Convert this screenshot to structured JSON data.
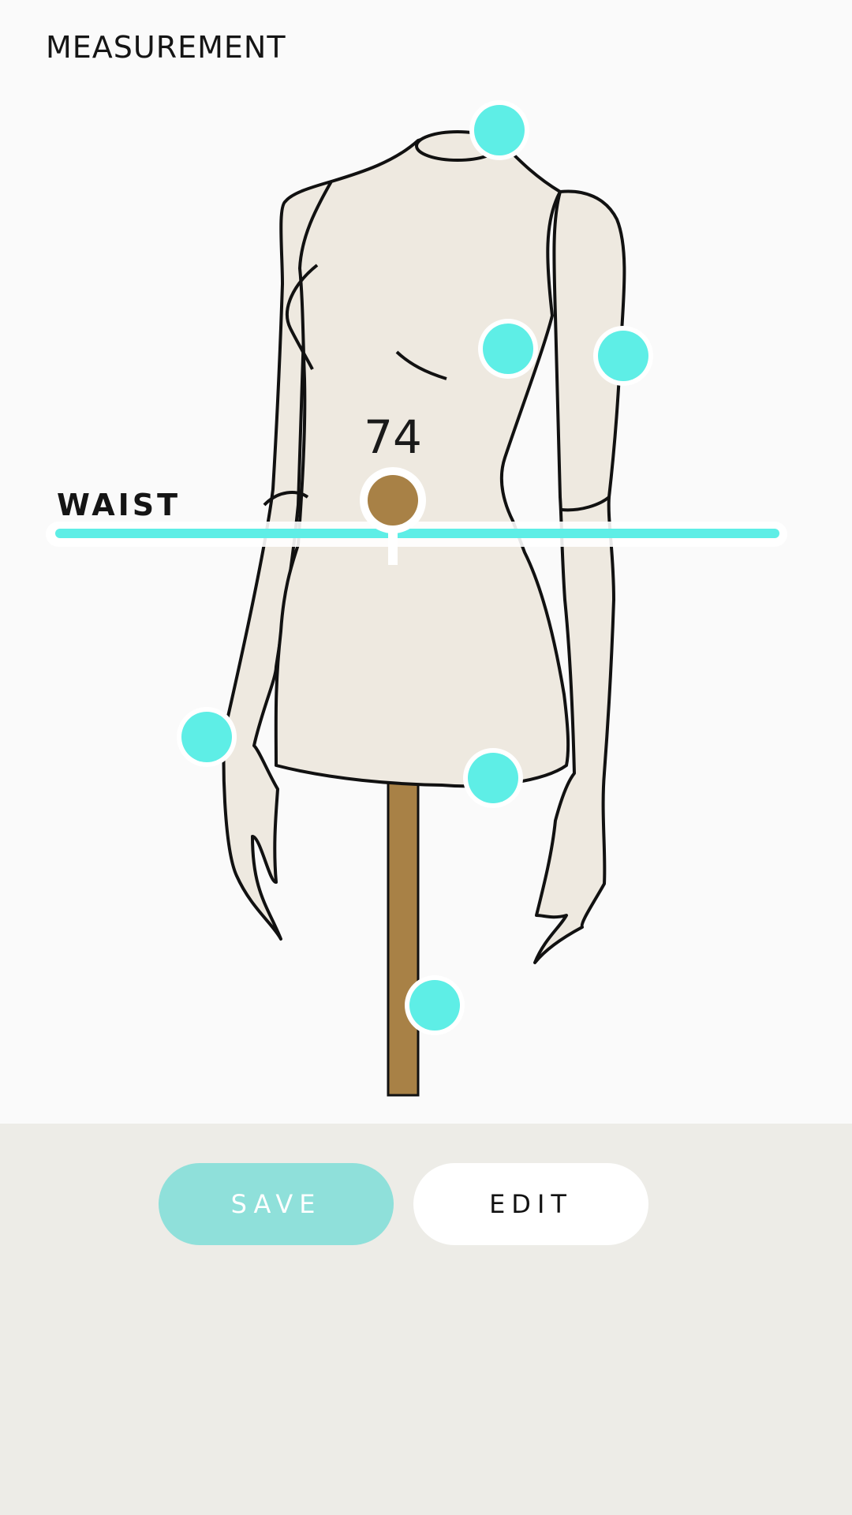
{
  "header": {
    "title": "MEASUREMENT"
  },
  "measurement": {
    "label": "WAIST",
    "value": "74"
  },
  "colors": {
    "accent": "#5eeee6",
    "active": "#a88146",
    "mannequin": "#eee9e0",
    "save": "#8fe0da"
  },
  "points": [
    {
      "name": "neck-point"
    },
    {
      "name": "bust-point"
    },
    {
      "name": "upper-arm-point"
    },
    {
      "name": "wrist-point"
    },
    {
      "name": "hip-point"
    },
    {
      "name": "leg-point"
    }
  ],
  "buttons": {
    "save_label": "SAVE",
    "edit_label": "EDIT"
  }
}
